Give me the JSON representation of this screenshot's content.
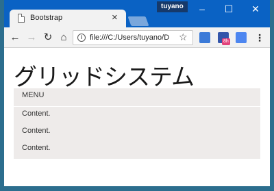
{
  "browser": {
    "tab_title": "Bootstrap",
    "tab_close": "×",
    "user_name": "tuyano",
    "url": "file:///C:/Users/tuyano/D",
    "ext_badge": "8h"
  },
  "window_controls": {
    "minimize": "–",
    "maximize": "☐",
    "close": "✕"
  },
  "nav": {
    "back": "←",
    "forward": "→",
    "reload": "↻",
    "home": "⌂"
  },
  "page": {
    "title": "グリッドシステム",
    "menu_label": "MENU",
    "content_items": [
      "Content.",
      "Content.",
      "Content."
    ]
  }
}
